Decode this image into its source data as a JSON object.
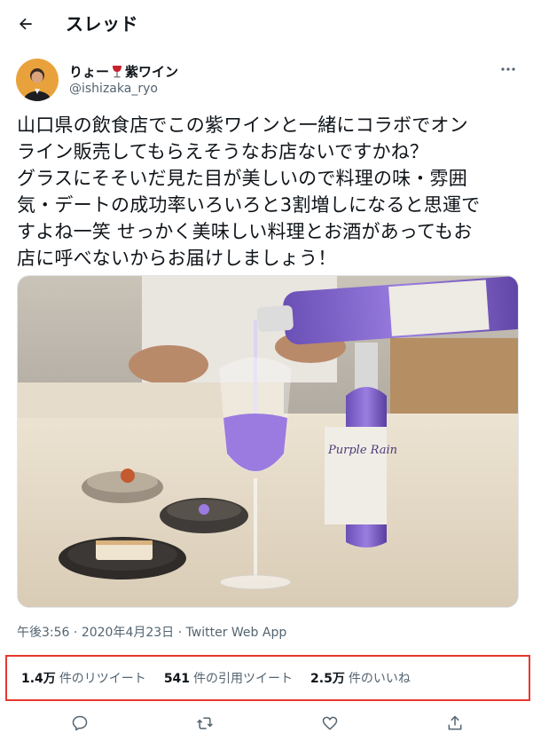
{
  "header": {
    "title": "スレッド"
  },
  "author": {
    "name": "りょー",
    "name_suffix": "紫ワイン",
    "handle": "@ishizaka_ryo"
  },
  "tweet": {
    "text": "山口県の飲食店でこの紫ワインと一緒にコラボでオン\nライン販売してもらえそうなお店ないですかね？\nグラスにそそいだ見た目が美しいので料理の味・雰囲\n気・デートの成功率いろいろと3割増しになると思運で\nすよね一笑 せっかく美味しい料理とお酒があってもお\n店に呼べないからお届けしましょう！"
  },
  "media": {
    "bottle_label": "Purple Rain"
  },
  "meta": {
    "time": "午後3:56",
    "date": "2020年4月23日",
    "source": "Twitter Web App",
    "separator": "·"
  },
  "stats": {
    "retweets": {
      "count": "1.4万",
      "label": "件のリツイート"
    },
    "quotes": {
      "count": "541",
      "label": "件の引用ツイート"
    },
    "likes": {
      "count": "2.5万",
      "label": "件のいいね"
    }
  },
  "colors": {
    "accent_border": "#e8382e",
    "text": "#0f1419",
    "secondary": "#536471",
    "wine_purple": "#8c6fd8"
  }
}
